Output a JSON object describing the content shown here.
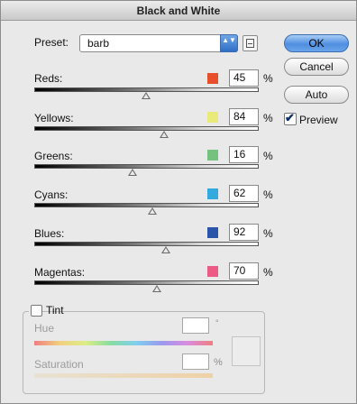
{
  "window": {
    "title": "Black and White"
  },
  "preset": {
    "label": "Preset:",
    "value": "barb",
    "arrows": "▲▼"
  },
  "buttons": {
    "ok": "OK",
    "cancel": "Cancel",
    "auto": "Auto"
  },
  "preview": {
    "label": "Preview",
    "checked": true,
    "check_glyph": "✔"
  },
  "percent_symbol": "%",
  "sliders": [
    {
      "label": "Reds:",
      "value": "45",
      "color": "#e8502c"
    },
    {
      "label": "Yellows:",
      "value": "84",
      "color": "#eaea7a"
    },
    {
      "label": "Greens:",
      "value": "16",
      "color": "#74c27e"
    },
    {
      "label": "Cyans:",
      "value": "62",
      "color": "#32aadf"
    },
    {
      "label": "Blues:",
      "value": "92",
      "color": "#2a55a8"
    },
    {
      "label": "Magentas:",
      "value": "70",
      "color": "#ee5a86"
    }
  ],
  "tint": {
    "label": "Tint",
    "checked": false,
    "hue_label": "Hue",
    "hue_value": "",
    "degree_symbol": "°",
    "saturation_label": "Saturation",
    "saturation_value": "",
    "saturation_unit": "%"
  },
  "icons": {
    "preset_arrows": "up-down-arrows-icon",
    "preset_menu": "preset-options-icon",
    "slider_thumb": "triangle-thumb-icon"
  }
}
